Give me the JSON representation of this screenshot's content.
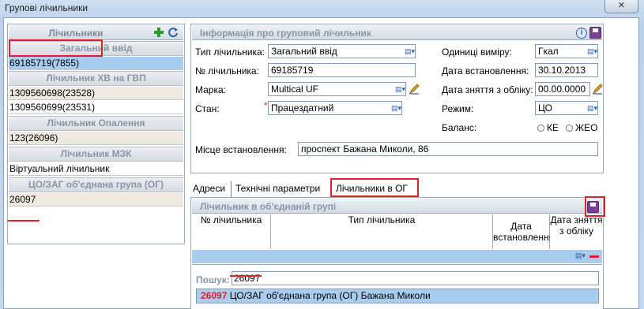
{
  "window": {
    "title": "Групові лічильники",
    "close_glyph": "✕"
  },
  "left": {
    "header": "Лічильники",
    "groups": [
      {
        "label": "Загальний ввід",
        "rows": [
          {
            "text": "69185719(7855)",
            "style": "sel"
          }
        ]
      },
      {
        "label": "Лічильник ХВ на ГВП",
        "rows": [
          {
            "text": "1309560698(23528)",
            "style": "beige"
          },
          {
            "text": "1309560699(23531)",
            "style": "white"
          }
        ]
      },
      {
        "label": "Лічильник Опалення",
        "rows": [
          {
            "text": "123(26096)",
            "style": "beige"
          }
        ]
      },
      {
        "label": "Лічильник МЗК",
        "rows": [
          {
            "text": "Віртуальний лічильник",
            "style": "white"
          }
        ]
      },
      {
        "label": "ЦО/ЗАГ об'єднана група (ОГ)",
        "rows": [
          {
            "text": "26097",
            "style": "beige"
          }
        ]
      }
    ]
  },
  "info": {
    "header": "Інформація про груповий лічильник",
    "type_label": "Тип лічильника:",
    "type_value": "Загальний ввід",
    "number_label": "№ лічильника:",
    "number_value": "69185719",
    "brand_label": "Марка:",
    "brand_value": "Multical UF",
    "state_label": "Стан:",
    "state_value": "Працездатний",
    "required_mark": "*",
    "units_label": "Одиниці виміру:",
    "units_value": "Гкал",
    "install_label": "Дата встановлення:",
    "install_value": "30.10.2013",
    "remove_label": "Дата зняття з обліку:",
    "remove_value": "00.00.0000",
    "mode_label": "Режим:",
    "mode_value": "ЦО",
    "balance_label": "Баланс:",
    "balance_opt1": "КЕ",
    "balance_opt2": "ЖЕО",
    "place_label": "Місце встановлення:",
    "place_value": "проспект Бажана Миколи, 86"
  },
  "tabs": [
    {
      "label": "Адреси"
    },
    {
      "label": "Технічні параметри"
    },
    {
      "label": "Лічильники в ОГ"
    }
  ],
  "og": {
    "header": "Лічильник в об'єднаній групі",
    "col_number": "№ лічильника",
    "col_type": "Тип лічильника",
    "col_install": "Дата встановлення",
    "col_remove": "Дата зняття з обліку",
    "search_label": "Пошук:",
    "search_value": "26097",
    "result_id": "26097",
    "result_text": "ЦО/ЗАГ об'єднана група (ОГ) Бажана Миколи"
  },
  "colors": {
    "highlight": "#e0202a",
    "selection": "#a9cdee",
    "accent": "#2b5fb0"
  }
}
